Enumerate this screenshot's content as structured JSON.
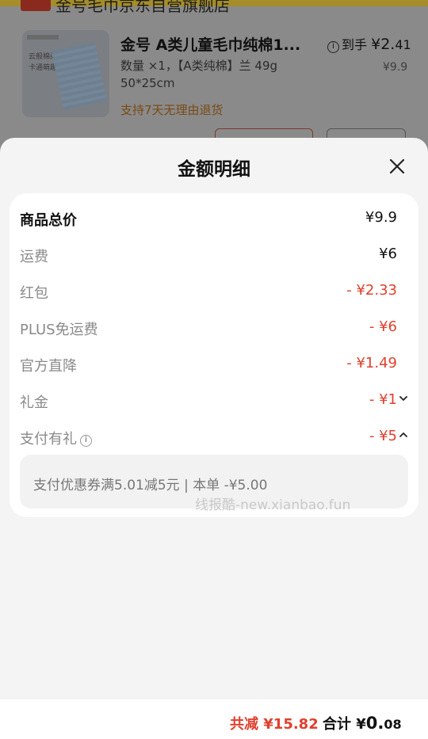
{
  "background": {
    "shop_name": "金号毛巾京东自营旗舰店",
    "product_title": "金号 A类儿童毛巾纯棉1...",
    "product_spec": "数量 ×1，【A类纯棉】兰 49g 50*25cm",
    "return_policy": "支持7天无理由退货",
    "final_label": "到手",
    "final_price_main": "¥2.",
    "final_price_dec": "41",
    "original_price": "¥9.9",
    "thumb_text_1": "云般棉柔",
    "thumb_text_2": "卡通萌趣"
  },
  "sheet": {
    "title": "金额明细",
    "rows": [
      {
        "label": "商品总价",
        "value": "¥9.9"
      },
      {
        "label": "运费",
        "value": "¥6"
      },
      {
        "label": "红包",
        "value": "- ¥2.33"
      },
      {
        "label": "PLUS免运费",
        "value": "- ¥6"
      },
      {
        "label": "官方直降",
        "value": "- ¥1.49"
      },
      {
        "label": "礼金",
        "value": "- ¥1"
      },
      {
        "label": "支付有礼",
        "value": "- ¥5"
      }
    ],
    "detail_text": "支付优惠券满5.01减5元 | 本单 -¥5.00",
    "watermark": "线报酷-new.xianbao.fun"
  },
  "footer": {
    "total_reduce": "共减 ¥15.82",
    "total_label": "合计 ¥",
    "total_int": "0.",
    "total_dec": "08"
  },
  "colors": {
    "accent_red": "#e0402e",
    "sheet_bg": "#f4f4f4",
    "card_bg": "#ffffff"
  },
  "icons": [
    "close-icon",
    "chevron-down-icon",
    "chevron-up-icon",
    "info-icon"
  ]
}
